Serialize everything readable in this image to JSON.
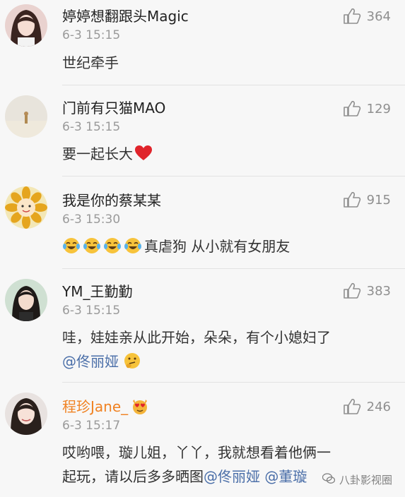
{
  "comments": [
    {
      "username": "婷婷想翻跟头Magic",
      "time": "6-3 15:15",
      "likes": "364",
      "text": "世纪牵手"
    },
    {
      "username": "门前有只猫MAO",
      "time": "6-3 15:15",
      "likes": "129",
      "text": "要一起长大"
    },
    {
      "username": "我是你的蔡某某",
      "time": "6-3 15:30",
      "likes": "915",
      "text": "真虐狗 从小就有女朋友"
    },
    {
      "username": "YM_王勤勤",
      "time": "6-3 15:15",
      "likes": "383",
      "text": "哇，娃娃亲从此开始，朵朵，有个小媳妇了",
      "mention": "@佟丽娅"
    },
    {
      "username": "程珍Jane_",
      "time": "6-3 15:17",
      "likes": "246",
      "text_line1": "哎哟喂，璇儿姐，丫丫，我就想看着他俩一",
      "text_line2": "起玩，请以后多多晒图",
      "mention": "@佟丽娅",
      "mention2": "@董璇"
    }
  ],
  "watermark": "八卦影视圈",
  "icons": {
    "like": "thumbs-up-icon",
    "heart": "red-heart-emoji",
    "laugh": "tears-of-joy-emoji",
    "thinking": "thinking-emoji",
    "heart_eyes": "heart-eyes-cat-emoji"
  },
  "colors": {
    "username_highlight": "#f08222",
    "mention": "#4a6ea8",
    "heart": "#e0242b"
  }
}
